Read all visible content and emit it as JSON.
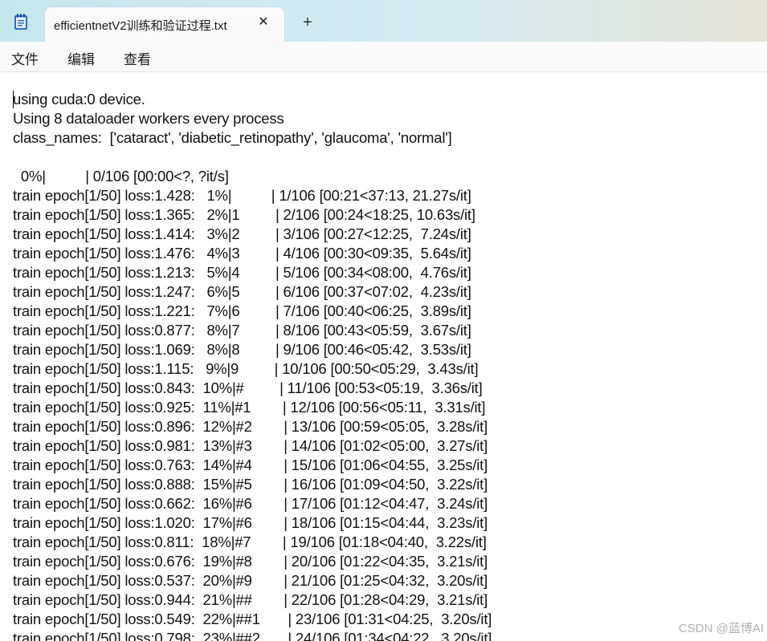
{
  "window": {
    "tab_title": "efficientnetV2训练和验证过程.txt",
    "close_glyph": "✕",
    "new_tab_glyph": "+",
    "app_icon": "notepad-icon"
  },
  "menu": [
    "文件",
    "编辑",
    "查看"
  ],
  "content": {
    "lines": [
      "using cuda:0 device.",
      "Using 8 dataloader workers every process",
      "class_names:  ['cataract', 'diabetic_retinopathy', 'glaucoma', 'normal']",
      "",
      "  0%|          | 0/106 [00:00<?, ?it/s]",
      "train epoch[1/50] loss:1.428:   1%|          | 1/106 [00:21<37:13, 21.27s/it]",
      "train epoch[1/50] loss:1.365:   2%|1         | 2/106 [00:24<18:25, 10.63s/it]",
      "train epoch[1/50] loss:1.414:   3%|2         | 3/106 [00:27<12:25,  7.24s/it]",
      "train epoch[1/50] loss:1.476:   4%|3         | 4/106 [00:30<09:35,  5.64s/it]",
      "train epoch[1/50] loss:1.213:   5%|4         | 5/106 [00:34<08:00,  4.76s/it]",
      "train epoch[1/50] loss:1.247:   6%|5         | 6/106 [00:37<07:02,  4.23s/it]",
      "train epoch[1/50] loss:1.221:   7%|6         | 7/106 [00:40<06:25,  3.89s/it]",
      "train epoch[1/50] loss:0.877:   8%|7         | 8/106 [00:43<05:59,  3.67s/it]",
      "train epoch[1/50] loss:1.069:   8%|8         | 9/106 [00:46<05:42,  3.53s/it]",
      "train epoch[1/50] loss:1.115:   9%|9         | 10/106 [00:50<05:29,  3.43s/it]",
      "train epoch[1/50] loss:0.843:  10%|#         | 11/106 [00:53<05:19,  3.36s/it]",
      "train epoch[1/50] loss:0.925:  11%|#1        | 12/106 [00:56<05:11,  3.31s/it]",
      "train epoch[1/50] loss:0.896:  12%|#2        | 13/106 [00:59<05:05,  3.28s/it]",
      "train epoch[1/50] loss:0.981:  13%|#3        | 14/106 [01:02<05:00,  3.27s/it]",
      "train epoch[1/50] loss:0.763:  14%|#4        | 15/106 [01:06<04:55,  3.25s/it]",
      "train epoch[1/50] loss:0.888:  15%|#5        | 16/106 [01:09<04:50,  3.22s/it]",
      "train epoch[1/50] loss:0.662:  16%|#6        | 17/106 [01:12<04:47,  3.24s/it]",
      "train epoch[1/50] loss:1.020:  17%|#6        | 18/106 [01:15<04:44,  3.23s/it]",
      "train epoch[1/50] loss:0.811:  18%|#7        | 19/106 [01:18<04:40,  3.22s/it]",
      "train epoch[1/50] loss:0.676:  19%|#8        | 20/106 [01:22<04:35,  3.21s/it]",
      "train epoch[1/50] loss:0.537:  20%|#9        | 21/106 [01:25<04:32,  3.20s/it]",
      "train epoch[1/50] loss:0.944:  21%|##        | 22/106 [01:28<04:29,  3.21s/it]",
      "train epoch[1/50] loss:0.549:  22%|##1       | 23/106 [01:31<04:25,  3.20s/it]",
      "train epoch[1/50] loss:0.798:  23%|##2       | 24/106 [01:34<04:22,  3.20s/it]"
    ]
  },
  "watermark": "CSDN @蓝博AI"
}
